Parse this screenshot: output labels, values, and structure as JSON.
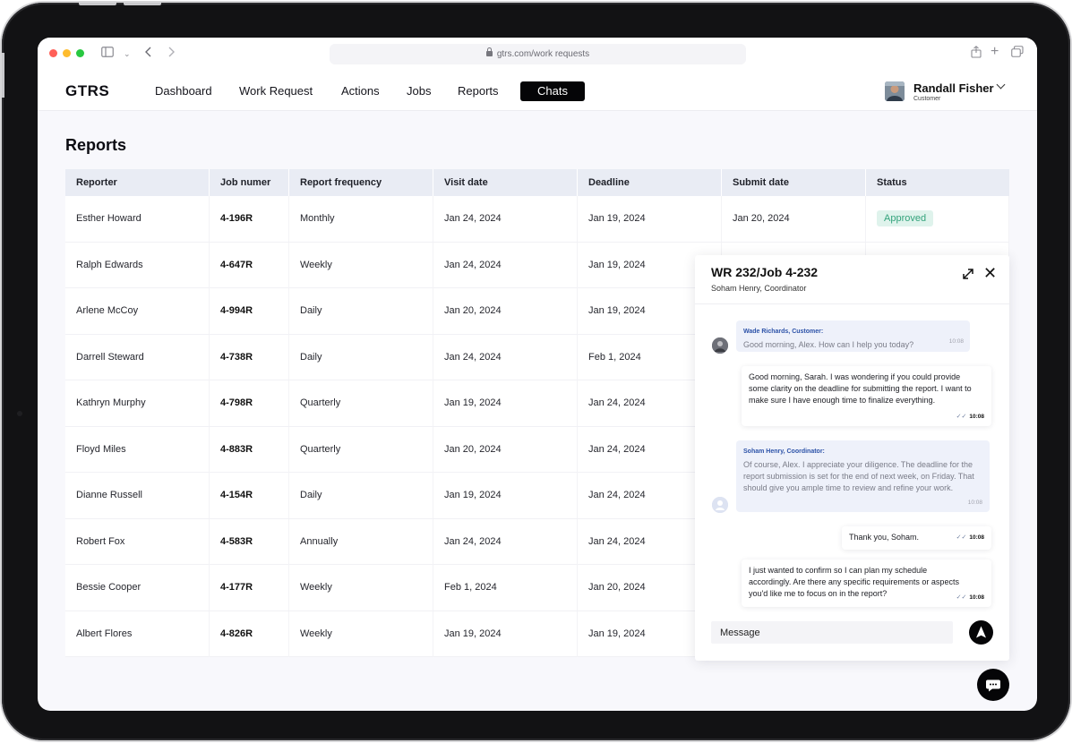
{
  "browser": {
    "url": "gtrs.com/work requests"
  },
  "header": {
    "logo": "GTRS",
    "nav": [
      "Dashboard",
      "Work Request",
      "Actions",
      "Jobs",
      "Reports"
    ],
    "nav_active": "Chats",
    "user": {
      "name": "Randall Fisher",
      "role": "Customer"
    }
  },
  "page": {
    "title": "Reports"
  },
  "table": {
    "columns": [
      "Reporter",
      "Job numer",
      "Report frequency",
      "Visit date",
      "Deadline",
      "Submit date",
      "Status"
    ],
    "rows": [
      {
        "reporter": "Esther Howard",
        "job": "4-196R",
        "frequency": "Monthly",
        "visit": "Jan 24, 2024",
        "deadline": "Jan 19, 2024",
        "submit": "Jan 20, 2024",
        "status": "Approved"
      },
      {
        "reporter": "Ralph Edwards",
        "job": "4-647R",
        "frequency": "Weekly",
        "visit": "Jan 24, 2024",
        "deadline": "Jan 19, 2024"
      },
      {
        "reporter": "Arlene McCoy",
        "job": "4-994R",
        "frequency": "Daily",
        "visit": "Jan 20, 2024",
        "deadline": "Jan 19, 2024"
      },
      {
        "reporter": "Darrell Steward",
        "job": "4-738R",
        "frequency": "Daily",
        "visit": "Jan 24, 2024",
        "deadline": "Feb 1, 2024"
      },
      {
        "reporter": "Kathryn Murphy",
        "job": "4-798R",
        "frequency": "Quarterly",
        "visit": "Jan 19, 2024",
        "deadline": "Jan 24, 2024"
      },
      {
        "reporter": "Floyd Miles",
        "job": "4-883R",
        "frequency": "Quarterly",
        "visit": "Jan 20, 2024",
        "deadline": "Jan 24, 2024"
      },
      {
        "reporter": "Dianne Russell",
        "job": "4-154R",
        "frequency": "Daily",
        "visit": "Jan 19, 2024",
        "deadline": "Jan 24, 2024"
      },
      {
        "reporter": "Robert Fox",
        "job": "4-583R",
        "frequency": "Annually",
        "visit": "Jan 24, 2024",
        "deadline": "Jan 24, 2024"
      },
      {
        "reporter": "Bessie Cooper",
        "job": "4-177R",
        "frequency": "Weekly",
        "visit": "Feb 1, 2024",
        "deadline": "Jan 20, 2024"
      },
      {
        "reporter": "Albert Flores",
        "job": "4-826R",
        "frequency": "Weekly",
        "visit": "Jan 19, 2024",
        "deadline": "Jan 19, 2024"
      }
    ]
  },
  "chat": {
    "title": "WR 232/Job 4-232",
    "subtitle": "Soham Henry, Coordinator",
    "messages": [
      {
        "sender": "Wade Richards, Customer:",
        "text": "Good morning, Alex. How can I help you today?",
        "time": "10:08"
      },
      {
        "text": "Good morning, Sarah. I was wondering if you could provide some clarity on the deadline for submitting the report. I want to make sure I have enough time to finalize everything.",
        "time": "10:08"
      },
      {
        "sender": "Soham Henry, Coordinator:",
        "text": "Of course, Alex. I appreciate your diligence. The deadline for the report submission is set for the end of next week, on Friday. That should give you ample time to review and refine your work.",
        "time": "10:08"
      },
      {
        "text": "Thank you, Soham.",
        "time": "10:08"
      },
      {
        "text": "I just wanted to confirm so I can plan my schedule accordingly. Are there any specific requirements or aspects you'd like me to focus on in the report?",
        "time": "10:08"
      }
    ],
    "input_placeholder": "Message"
  },
  "colors": {
    "accent": "#050507",
    "approved_bg": "#dff3ec",
    "approved_text": "#34a37c"
  }
}
